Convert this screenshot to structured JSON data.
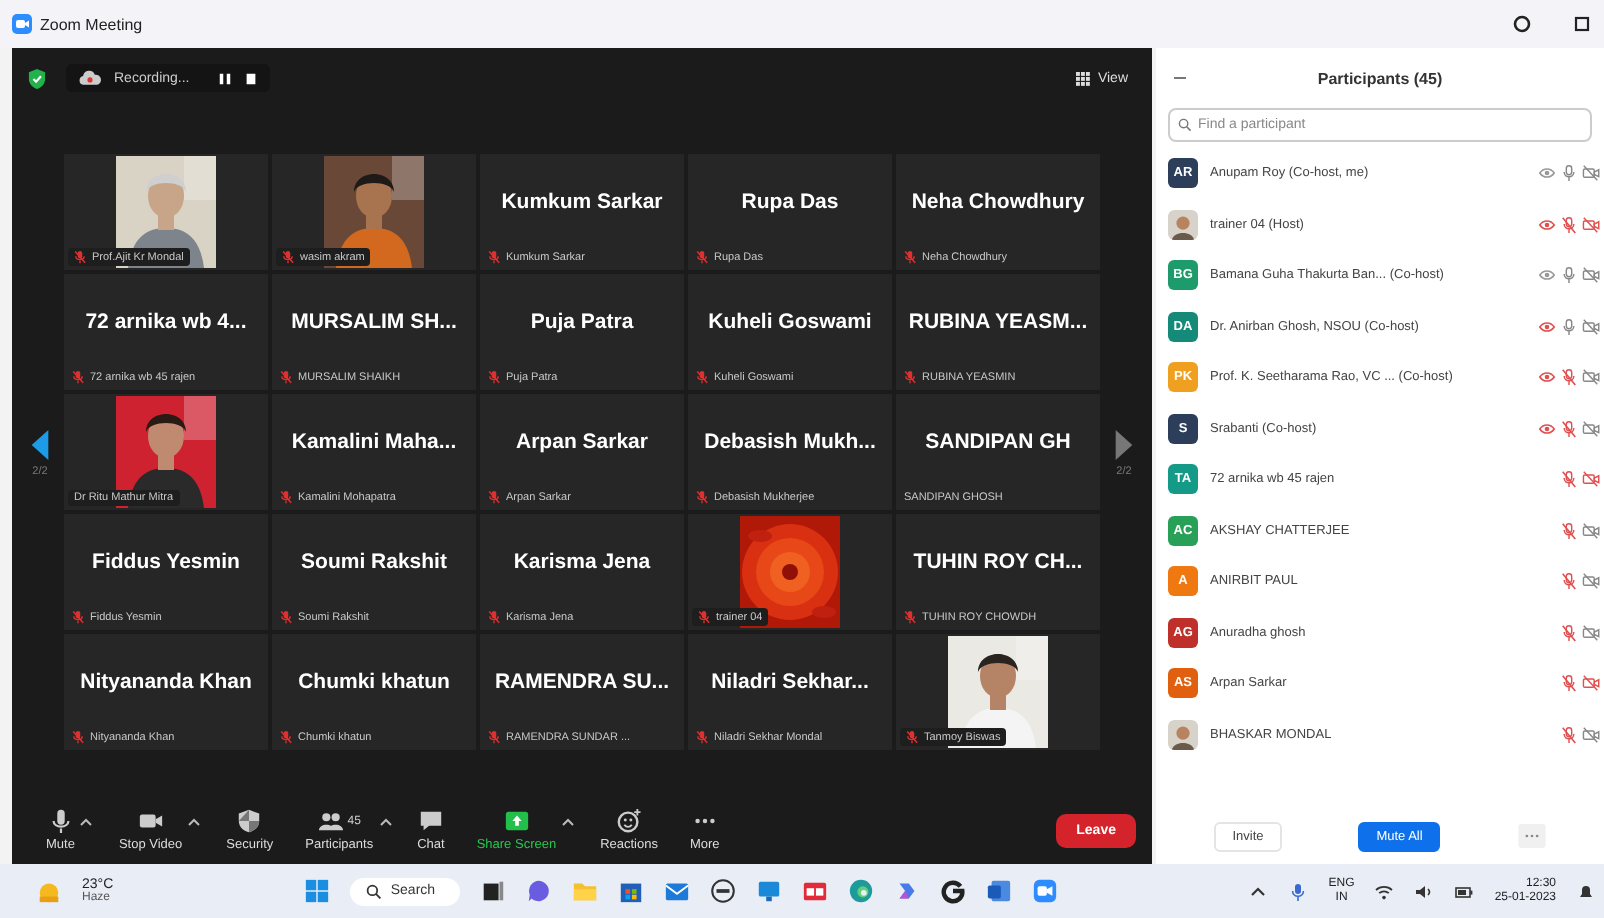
{
  "window": {
    "title": "Zoom Meeting"
  },
  "top_bar": {
    "recording": "Recording...",
    "view_button": "View"
  },
  "pager": [
    {
      "label": "2/2",
      "enabled": true
    },
    {
      "label": "2/2",
      "enabled": false
    }
  ],
  "tiles": [
    {
      "kind": "picture",
      "label": "Prof.Ajit Kr Mondal",
      "muted": true
    },
    {
      "kind": "picture",
      "label": "wasim akram",
      "muted": true
    },
    {
      "kind": "name",
      "title": "Kumkum Sarkar",
      "label": "Kumkum Sarkar",
      "muted": true
    },
    {
      "kind": "name",
      "title": "Rupa Das",
      "label": "Rupa Das",
      "muted": true
    },
    {
      "kind": "name",
      "title": "Neha Chowdhury",
      "label": "Neha Chowdhury",
      "muted": true
    },
    {
      "kind": "name",
      "title": "72  arnika wb 4...",
      "label": "72 arnika wb 45 rajen",
      "muted": true
    },
    {
      "kind": "name",
      "title": "MURSALIM SH...",
      "label": "MURSALIM SHAIKH",
      "muted": true
    },
    {
      "kind": "name",
      "title": "Puja Patra",
      "label": "Puja Patra",
      "muted": true
    },
    {
      "kind": "name",
      "title": "Kuheli Goswami",
      "label": "Kuheli Goswami",
      "muted": true
    },
    {
      "kind": "name",
      "title": "RUBINA  YEASM...",
      "label": "RUBINA YEASMIN",
      "muted": true
    },
    {
      "kind": "picture",
      "label": "Dr Ritu Mathur Mitra",
      "muted": false
    },
    {
      "kind": "name",
      "title": "Kamalini  Maha...",
      "label": "Kamalini Mohapatra",
      "muted": true
    },
    {
      "kind": "name",
      "title": "Arpan Sarkar",
      "label": "Arpan Sarkar",
      "muted": true
    },
    {
      "kind": "name",
      "title": "Debasish  Mukh...",
      "label": "Debasish Mukherjee",
      "muted": true
    },
    {
      "kind": "name",
      "title": "SANDIPAN  GH",
      "label": "SANDIPAN GHOSH",
      "muted": false
    },
    {
      "kind": "name",
      "title": "Fiddus Yesmin",
      "label": "Fiddus Yesmin",
      "muted": true
    },
    {
      "kind": "name",
      "title": "Soumi Rakshit",
      "label": "Soumi Rakshit",
      "muted": true
    },
    {
      "kind": "name",
      "title": "Karisma Jena",
      "label": "Karisma Jena",
      "muted": true
    },
    {
      "kind": "picture",
      "label": "trainer 04",
      "muted": true
    },
    {
      "kind": "name",
      "title": "TUHIN  ROY  CH...",
      "label": "TUHIN ROY CHOWDH",
      "muted": true
    },
    {
      "kind": "name",
      "title": "Nityananda Khan",
      "label": "Nityananda Khan",
      "muted": true
    },
    {
      "kind": "name",
      "title": "Chumki khatun",
      "label": "Chumki khatun",
      "muted": true
    },
    {
      "kind": "name",
      "title": "RAMENDRA  SU...",
      "label": "RAMENDRA SUNDAR ...",
      "muted": true
    },
    {
      "kind": "name",
      "title": "Niladri  Sekhar...",
      "label": "Niladri Sekhar Mondal",
      "muted": true
    },
    {
      "kind": "picture",
      "label": "Tanmoy Biswas",
      "muted": true
    }
  ],
  "toolbar": [
    {
      "kind": "mic",
      "label": "Mute",
      "caret": true
    },
    {
      "kind": "video",
      "label": "Stop Video",
      "caret": true
    },
    {
      "kind": "security",
      "label": "Security",
      "caret": false
    },
    {
      "kind": "participants",
      "label": "Participants",
      "count": "45",
      "caret": true
    },
    {
      "kind": "chat",
      "label": "Chat",
      "caret": false
    },
    {
      "kind": "share",
      "label": "Share Screen",
      "caret": true
    },
    {
      "kind": "reactions",
      "label": "Reactions",
      "caret": false
    },
    {
      "kind": "more",
      "label": "More",
      "caret": false
    }
  ],
  "leave_button": "Leave",
  "panel": {
    "title": "Participants (45)",
    "search": {
      "placeholder": "Find a participant"
    },
    "participants": [
      {
        "initials": "AR",
        "color": "#2c3e5a",
        "name": "Anupam Roy (Co-host, me)",
        "mic_muted": false,
        "video_alert": false,
        "eye_alert": false
      },
      {
        "kind": "picture",
        "name": "trainer 04 (Host)",
        "mic_muted": true,
        "video_alert": true,
        "eye_alert": true
      },
      {
        "initials": "BG",
        "color": "#1e9b6a",
        "name": "Bamana Guha Thakurta Ban...  (Co-host)",
        "mic_muted": false,
        "video_alert": false,
        "eye_alert": false
      },
      {
        "initials": "DA",
        "color": "#168a78",
        "name": "Dr. Anirban Ghosh, NSOU (Co-host)",
        "mic_muted": false,
        "video_alert": false,
        "eye_alert": true
      },
      {
        "initials": "PK",
        "color": "#f0a020",
        "name": "Prof. K. Seetharama Rao, VC ... (Co-host)",
        "mic_muted": true,
        "video_alert": false,
        "eye_alert": true
      },
      {
        "initials": "S",
        "color": "#2c3e5a",
        "name": "Srabanti (Co-host)",
        "mic_muted": true,
        "video_alert": false,
        "eye_alert": true
      },
      {
        "initials": "TA",
        "color": "#169a88",
        "name": "72 arnika wb 45 rajen",
        "mic_muted": true,
        "video_alert": true
      },
      {
        "initials": "AC",
        "color": "#28a058",
        "name": "AKSHAY CHATTERJEE",
        "mic_muted": true,
        "video_alert": false
      },
      {
        "initials": "A",
        "color": "#f07810",
        "name": "ANIRBIT PAUL",
        "mic_muted": true,
        "video_alert": false
      },
      {
        "initials": "AG",
        "color": "#c0302a",
        "name": "Anuradha ghosh",
        "mic_muted": true,
        "video_alert": false
      },
      {
        "initials": "AS",
        "color": "#e06010",
        "name": "Arpan Sarkar",
        "mic_muted": true,
        "video_alert": true
      },
      {
        "kind": "picture",
        "name": "BHASKAR MONDAL",
        "mic_muted": true,
        "video_alert": false
      }
    ],
    "buttons": [
      "Invite",
      "Mute All"
    ]
  },
  "taskbar": {
    "temperature": "23°C",
    "weather": "Haze",
    "search": "Search",
    "language": "ENG",
    "region": "IN",
    "time": "12:30",
    "date": "25-01-2023"
  }
}
